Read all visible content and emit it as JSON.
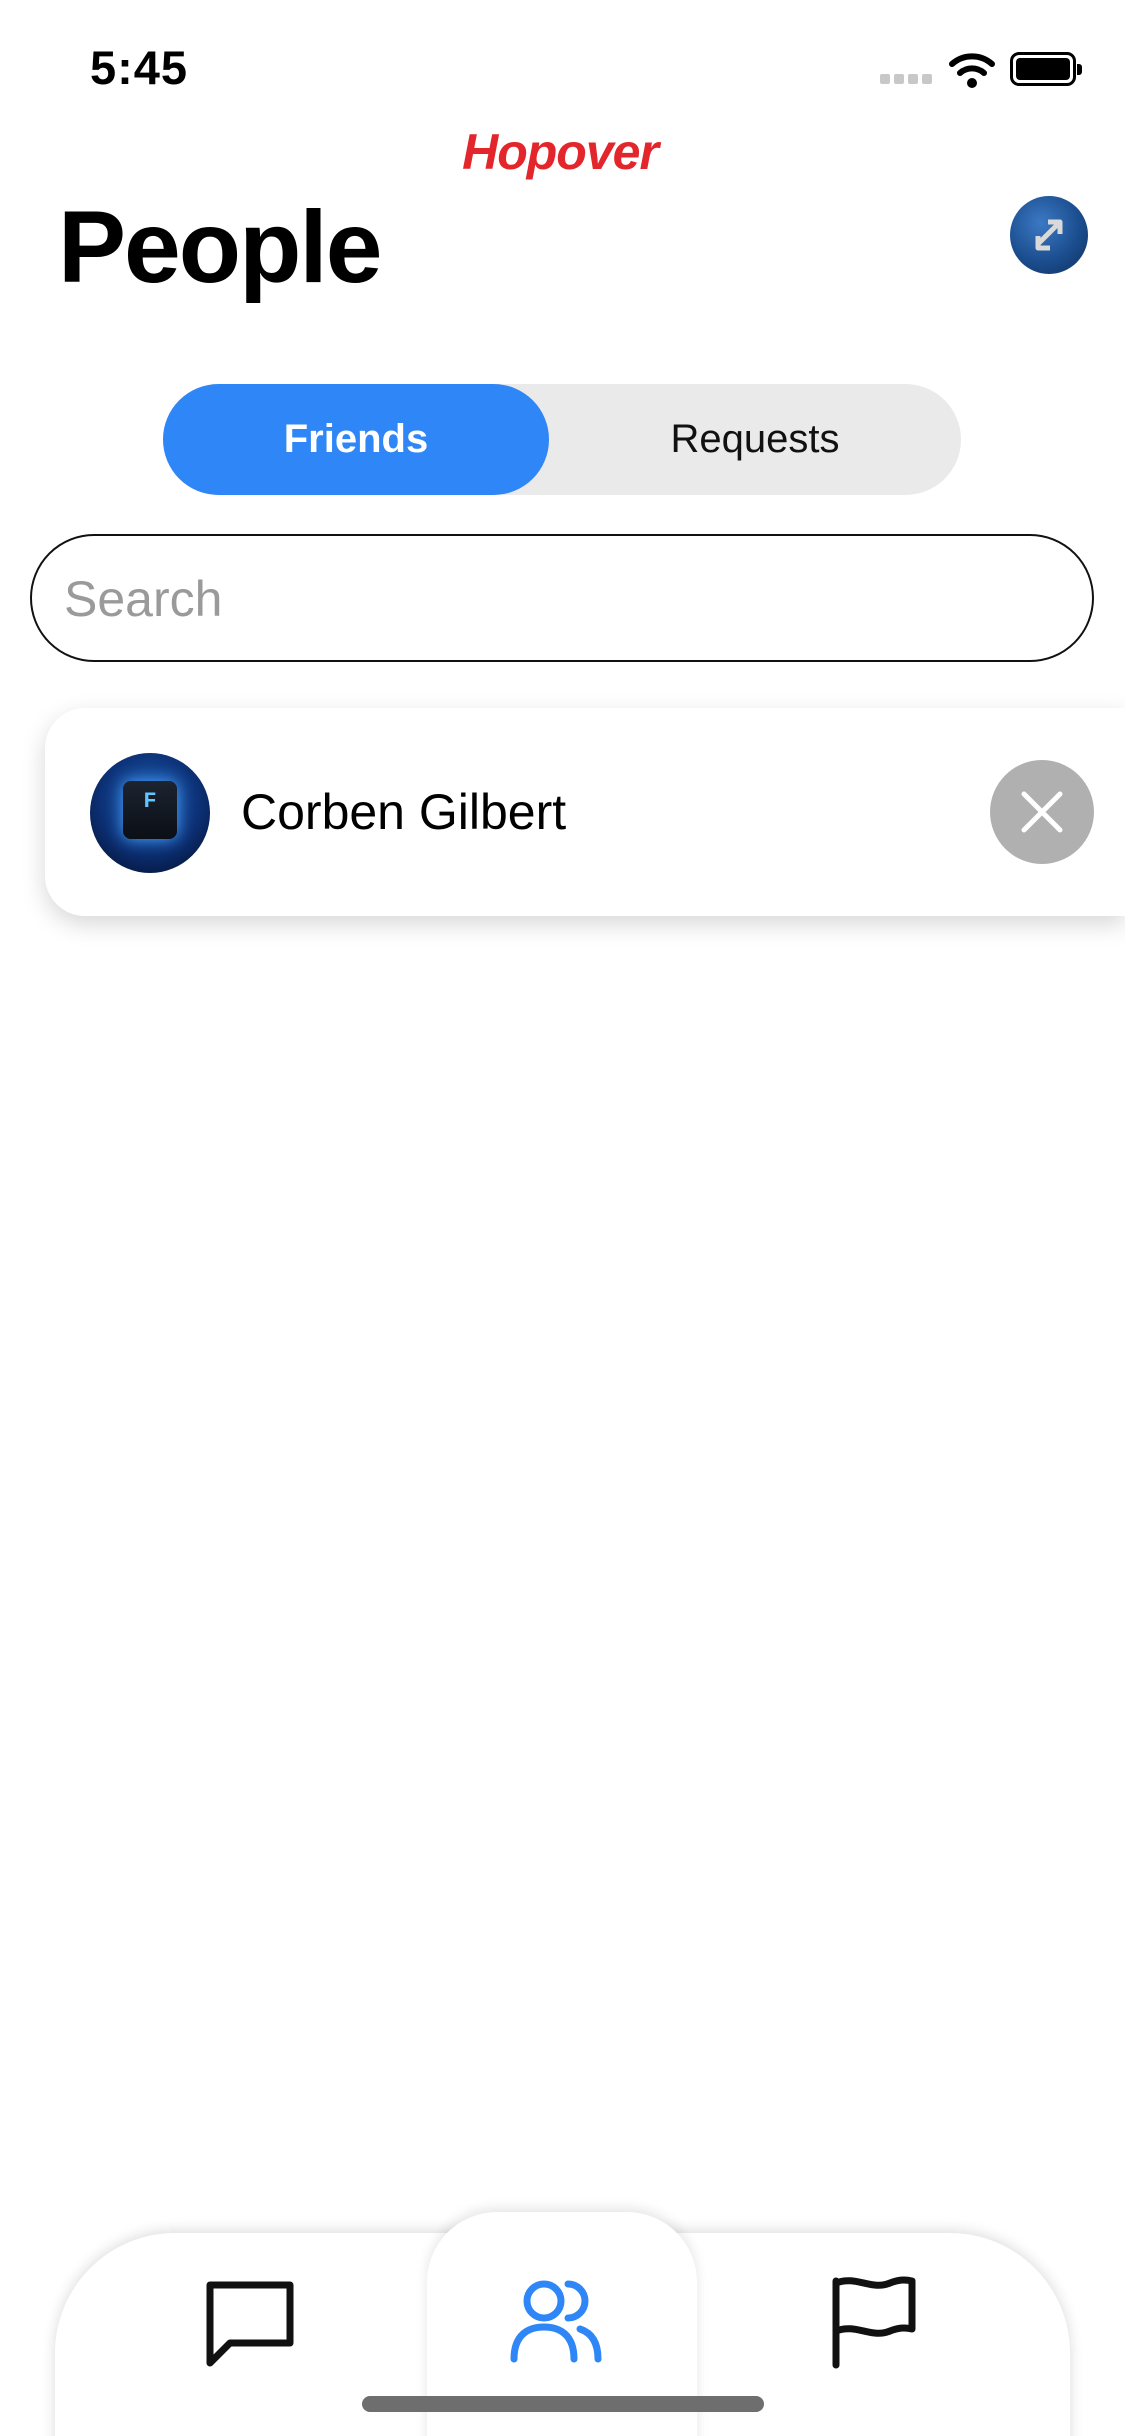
{
  "status_bar": {
    "time": "5:45",
    "icons": [
      "signal-icon",
      "wifi-icon",
      "battery-icon"
    ]
  },
  "app": {
    "logo_text": "Hopover",
    "brand_color": "#e3262b"
  },
  "header": {
    "title": "People",
    "profile_icon": "swap-arrows-icon"
  },
  "segments": {
    "active_label": "Friends",
    "inactive_label": "Requests",
    "accent": "#2f86f6"
  },
  "search": {
    "placeholder": "Search",
    "value": ""
  },
  "friends": [
    {
      "name": "Corben Gilbert",
      "avatar": "keyboard-key-f",
      "action_icon": "close-icon"
    }
  ],
  "tabbar": {
    "items": [
      {
        "icon": "chat-bubble-icon",
        "active": false
      },
      {
        "icon": "people-icon",
        "active": true
      },
      {
        "icon": "flag-icon",
        "active": false
      }
    ]
  }
}
